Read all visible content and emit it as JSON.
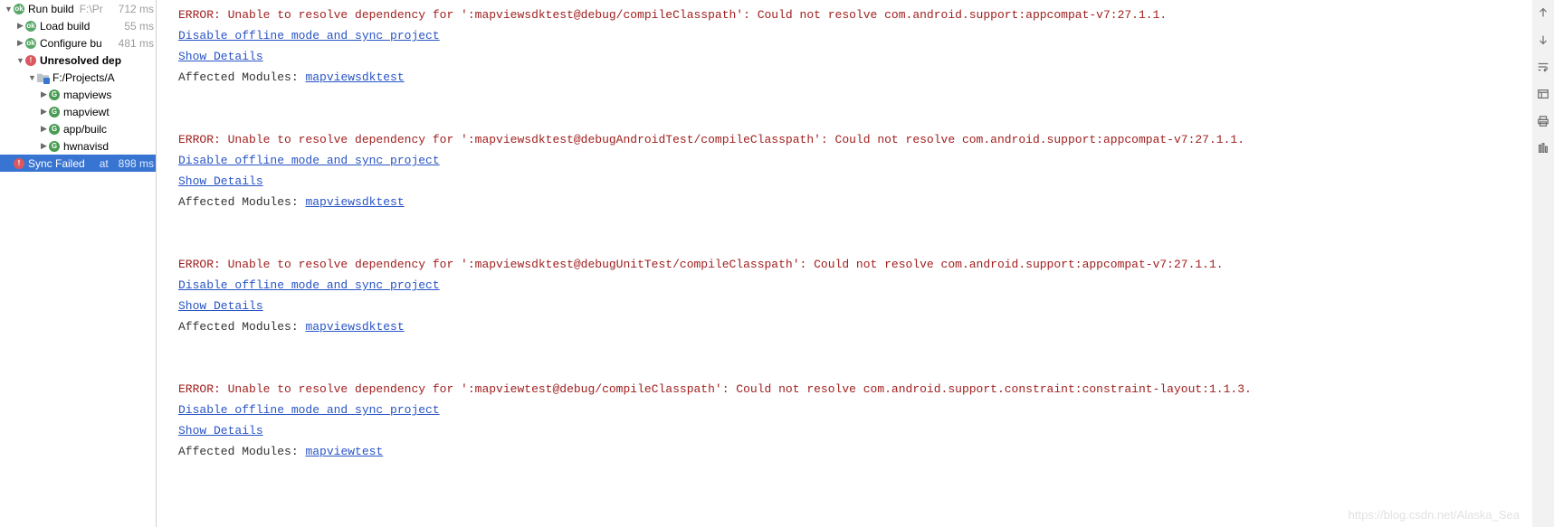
{
  "tree": {
    "run_build": {
      "label": "Run build",
      "path": "F:\\Pr",
      "time": "712 ms"
    },
    "load_build": {
      "label": "Load build",
      "time": "55 ms"
    },
    "configure_bu": {
      "label": "Configure bu",
      "time": "481 ms"
    },
    "unresolved": {
      "label": "Unresolved dep"
    },
    "project_folder": {
      "label": "F:/Projects/A"
    },
    "modules": [
      {
        "label": "mapviews"
      },
      {
        "label": "mapviewt"
      },
      {
        "label": "app/builc"
      },
      {
        "label": "hwnavisd"
      }
    ],
    "sync_failed": {
      "label": "Sync Failed",
      "path": "at",
      "time": "898 ms"
    }
  },
  "links": {
    "disable_offline": "Disable offline mode and sync project",
    "show_details": "Show Details",
    "affected_prefix": "Affected Modules: "
  },
  "errors": [
    {
      "message": "ERROR: Unable to resolve dependency for ':mapviewsdktest@debug/compileClasspath': Could not resolve com.android.support:appcompat-v7:27.1.1.",
      "module": "mapviewsdktest"
    },
    {
      "message": "ERROR: Unable to resolve dependency for ':mapviewsdktest@debugAndroidTest/compileClasspath': Could not resolve com.android.support:appcompat-v7:27.1.1.",
      "module": "mapviewsdktest"
    },
    {
      "message": "ERROR: Unable to resolve dependency for ':mapviewsdktest@debugUnitTest/compileClasspath': Could not resolve com.android.support:appcompat-v7:27.1.1.",
      "module": "mapviewsdktest"
    },
    {
      "message": "ERROR: Unable to resolve dependency for ':mapviewtest@debug/compileClasspath': Could not resolve com.android.support.constraint:constraint-layout:1.1.3.",
      "module": "mapviewtest"
    }
  ],
  "watermark": "https://blog.csdn.net/Alaska_Sea",
  "gutter_icons": [
    "arrow-up",
    "arrow-down",
    "wrap-icon",
    "layout-icon",
    "print-icon",
    "filter-icon"
  ]
}
